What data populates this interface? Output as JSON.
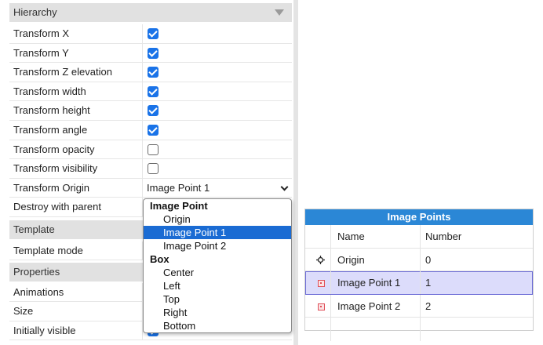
{
  "props": {
    "sections": {
      "hierarchy": "Hierarchy",
      "template": "Template",
      "properties": "Properties"
    },
    "rows": {
      "transform_x": {
        "label": "Transform X",
        "checked": true
      },
      "transform_y": {
        "label": "Transform Y",
        "checked": true
      },
      "transform_z": {
        "label": "Transform Z elevation",
        "checked": true
      },
      "transform_width": {
        "label": "Transform width",
        "checked": true
      },
      "transform_height": {
        "label": "Transform height",
        "checked": true
      },
      "transform_angle": {
        "label": "Transform angle",
        "checked": true
      },
      "transform_opacity": {
        "label": "Transform opacity",
        "checked": false
      },
      "transform_visibility": {
        "label": "Transform visibility",
        "checked": false
      },
      "transform_origin": {
        "label": "Transform Origin",
        "value": "Image Point 1"
      },
      "destroy_with_parent": {
        "label": "Destroy with parent"
      },
      "template_mode": {
        "label": "Template mode"
      },
      "animations": {
        "label": "Animations"
      },
      "size": {
        "label": "Size"
      },
      "initially_visible": {
        "label": "Initially visible",
        "checked": true
      }
    }
  },
  "dropdown": {
    "groups": [
      {
        "label": "Image Point",
        "options": [
          "Origin",
          "Image Point 1",
          "Image Point 2"
        ]
      },
      {
        "label": "Box",
        "options": [
          "Center",
          "Left",
          "Top",
          "Right",
          "Bottom"
        ]
      }
    ],
    "selected": "Image Point 1"
  },
  "image_points": {
    "title": "Image Points",
    "columns": {
      "name": "Name",
      "number": "Number"
    },
    "rows": [
      {
        "name": "Origin",
        "number": "0",
        "icon": "origin-crosshair-icon"
      },
      {
        "name": "Image Point 1",
        "number": "1",
        "icon": "image-point-icon",
        "selected": true
      },
      {
        "name": "Image Point 2",
        "number": "2",
        "icon": "image-point-icon"
      }
    ]
  },
  "colors": {
    "accent": "#1a73e8",
    "dropdown_selected": "#1a6bd3",
    "panel_header": "#2b87d6",
    "row_selected": "#dcdcfb",
    "section_bg": "#e1e1e1"
  }
}
